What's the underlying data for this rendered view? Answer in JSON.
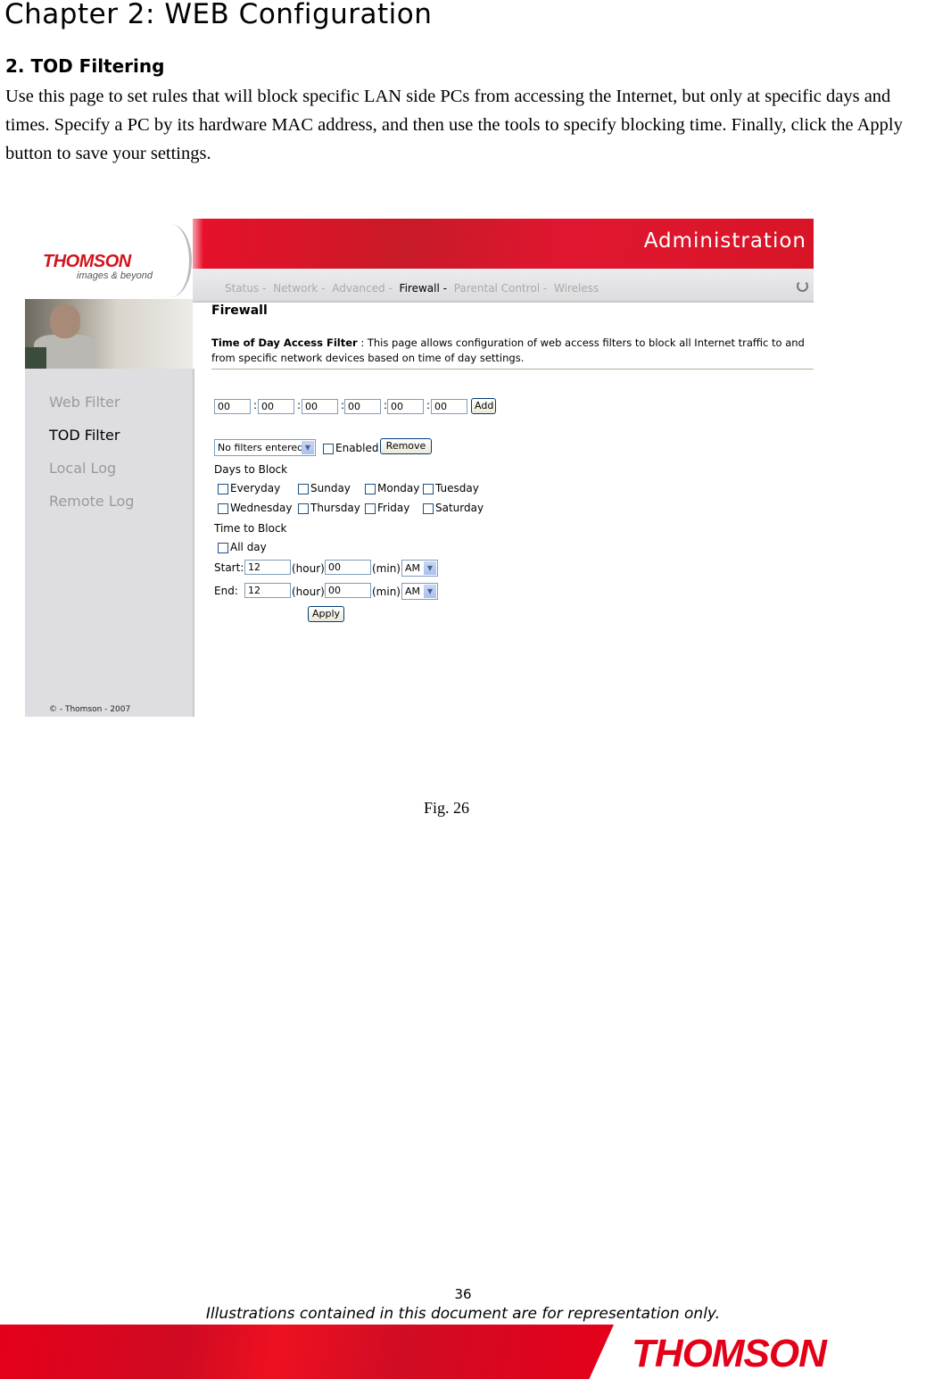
{
  "document": {
    "chapter_title": "Chapter 2: WEB Configuration",
    "section_title": "2. TOD Filtering",
    "paragraph": "Use this page to set rules that will block specific LAN side PCs from accessing the Internet, but only at specific days and times. Specify a PC by its hardware MAC address, and then use the tools to specify blocking time. Finally, click the Apply button to save your settings.",
    "figure_caption": "Fig. 26",
    "page_number": "36",
    "disclaimer": "Illustrations contained in this document are for representation only.",
    "footer_logo": "THOMSON"
  },
  "screenshot": {
    "logo": "THOMSON",
    "logo_tagline": "images & beyond",
    "banner_title": "Administration",
    "nav": [
      {
        "label": "Status -",
        "active": false
      },
      {
        "label": "Network -",
        "active": false
      },
      {
        "label": "Advanced -",
        "active": false
      },
      {
        "label": "Firewall -",
        "active": true
      },
      {
        "label": "Parental Control -",
        "active": false
      },
      {
        "label": "Wireless",
        "active": false
      }
    ],
    "sidebar": [
      {
        "label": "Web Filter",
        "active": false
      },
      {
        "label": "TOD Filter",
        "active": true
      },
      {
        "label": "Local Log",
        "active": false
      },
      {
        "label": "Remote Log",
        "active": false
      }
    ],
    "copyright": "© - Thomson - 2007",
    "page_title": "Firewall",
    "desc_label": "Time of Day Access Filter",
    "desc_text": " :  This page allows configuration of web access filters to block all Internet traffic to and from specific network devices based on time of day settings.",
    "mac_fields": [
      "00",
      "00",
      "00",
      "00",
      "00",
      "00"
    ],
    "mac_separator": ":",
    "add_button": "Add",
    "filter_select": "No filters entered.",
    "enabled_label": "Enabled",
    "remove_button": "Remove",
    "days_heading": "Days to Block",
    "days": [
      "Everyday",
      "Sunday",
      "Monday",
      "Tuesday",
      "Wednesday",
      "Thursday",
      "Friday",
      "Saturday"
    ],
    "time_heading": "Time to Block",
    "allday_label": "All day",
    "start_label": "Start:",
    "end_label": "End:",
    "hour_label": "(hour)",
    "min_label": "(min)",
    "start_hour": "12",
    "start_min": "00",
    "start_ampm": "AM",
    "end_hour": "12",
    "end_min": "00",
    "end_ampm": "AM",
    "apply_button": "Apply"
  }
}
